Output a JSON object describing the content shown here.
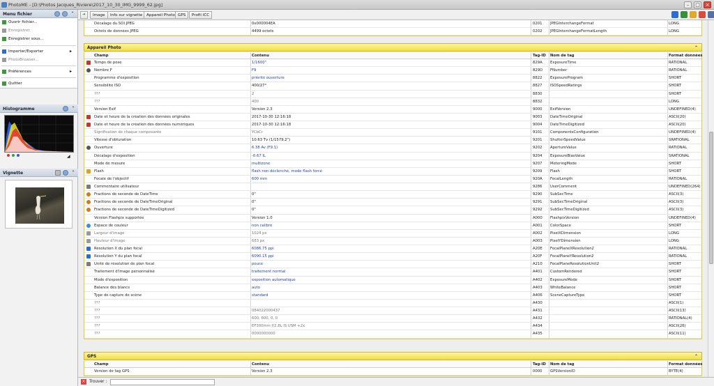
{
  "window": {
    "title": "PhotoME - [D:\\Photos Jacques_Riviere\\2017_10_30_IMG_9999_62.jpg]"
  },
  "left": {
    "menu_title": "Menu fichier",
    "menu": [
      {
        "label": "Ouvrir fichier...",
        "enabled": true,
        "icon": "open-folder-icon"
      },
      {
        "label": "Enregistrer",
        "enabled": false,
        "icon": "save-icon"
      },
      {
        "label": "Enregistrer sous...",
        "enabled": true,
        "icon": "save-as-icon"
      },
      {
        "label": "Importer/Exporter",
        "enabled": true,
        "icon": "import-export-icon",
        "submenu": true
      },
      {
        "label": "PhotoBrowser...",
        "enabled": false,
        "icon": "photo-browser-icon"
      },
      {
        "label": "Préférences",
        "enabled": true,
        "icon": "preferences-icon",
        "submenu": true
      },
      {
        "label": "Quitter",
        "enabled": true,
        "icon": "quit-icon"
      }
    ],
    "histogram_title": "Histogramme",
    "vignette_title": "Vignette"
  },
  "toolbar": {
    "tabs": [
      "Image",
      "Info sur vignette",
      "Appareil Photo",
      "GPS",
      "Profil ICC"
    ]
  },
  "columns": {
    "champ": "Champ",
    "contenu": "Contenu",
    "tag": "Tag-ID",
    "nom": "Nom de tag",
    "format": "Format données"
  },
  "top_rows": [
    {
      "champ": "Décalage du SOI JPEG",
      "contenu": "0x000004EA",
      "tag": "0201",
      "nom": "JPEGInterchangeFormat",
      "format": "LONG"
    },
    {
      "champ": "Octets de données JPEG",
      "contenu": "4499 octets",
      "tag": "0202",
      "nom": "JPEGInterchangeFormatLength",
      "format": "LONG"
    }
  ],
  "camera_section": {
    "title": "Appareil Photo",
    "rows": [
      {
        "champ": "Temps de pose",
        "contenu": "1/1600\"",
        "tag": "829A",
        "nom": "ExposureTime",
        "format": "RATIONAL",
        "icon": "stopwatch-icon",
        "style": "blue"
      },
      {
        "champ": "Nombre F",
        "contenu": "F9",
        "tag": "829D",
        "nom": "FNumber",
        "format": "RATIONAL",
        "icon": "aperture-icon",
        "style": "blue"
      },
      {
        "champ": "Programme d'exposition",
        "contenu": "priorité ouverture",
        "tag": "8822",
        "nom": "ExposureProgram",
        "format": "SHORT",
        "style": "blue"
      },
      {
        "champ": "Sensibilité ISO",
        "contenu": "400/27°",
        "tag": "8827",
        "nom": "ISOSpeedRatings",
        "format": "SHORT"
      },
      {
        "champ": "???",
        "contenu": "2",
        "tag": "8830",
        "nom": "",
        "format": "SHORT",
        "style": "gray"
      },
      {
        "champ": "???",
        "contenu": "400",
        "tag": "8832",
        "nom": "",
        "format": "LONG",
        "style": "gray"
      },
      {
        "champ": "Version Exif",
        "contenu": "Version 2.3",
        "tag": "9000",
        "nom": "ExifVersion",
        "format": "UNDEFINED(4)"
      },
      {
        "champ": "Date et heure de la création des données originales",
        "contenu": "2017-10-30 12:16:18",
        "tag": "9003",
        "nom": "DateTimeOriginal",
        "format": "ASCII(20)",
        "icon": "calendar-icon"
      },
      {
        "champ": "Date et heure de la création des données numériques",
        "contenu": "2017-10-30 12:16:18",
        "tag": "9004",
        "nom": "DateTimeDigitized",
        "format": "ASCII(20)",
        "icon": "calendar-icon"
      },
      {
        "champ": "Signification de chaque composante",
        "contenu": "YCbCr",
        "tag": "9101",
        "nom": "ComponentsConfiguration",
        "format": "UNDEFINED(4)",
        "style": "gray"
      },
      {
        "champ": "Vitesse d'obturation",
        "contenu": "10.63 Tv (1/1579.2\")",
        "tag": "9201",
        "nom": "ShutterSpeedValue",
        "format": "SRATIONAL"
      },
      {
        "champ": "Ouverture",
        "contenu": "6.38 Av (F9.1)",
        "tag": "9202",
        "nom": "ApertureValue",
        "format": "RATIONAL",
        "icon": "aperture-icon",
        "style": "blue"
      },
      {
        "champ": "Décalage d'exposition",
        "contenu": "-0.67 IL",
        "tag": "9204",
        "nom": "ExposureBiasValue",
        "format": "SRATIONAL",
        "style": "blue"
      },
      {
        "champ": "Mode de mesure",
        "contenu": "multizone",
        "tag": "9207",
        "nom": "MeteringMode",
        "format": "SHORT",
        "style": "blue"
      },
      {
        "champ": "Flash",
        "contenu": "flash non déclenché, mode flash forcé",
        "tag": "9209",
        "nom": "Flash",
        "format": "SHORT",
        "icon": "flash-icon",
        "style": "blue"
      },
      {
        "champ": "Focale de l'objectif",
        "contenu": "600 mm",
        "tag": "920A",
        "nom": "FocalLength",
        "format": "RATIONAL",
        "style": "blue"
      },
      {
        "champ": "Commentaire utilisateur",
        "contenu": "",
        "tag": "9286",
        "nom": "UserComment",
        "format": "UNDEFINED(264)",
        "icon": "comment-icon"
      },
      {
        "champ": "Fractions de seconde de DateTime",
        "contenu": "0\"",
        "tag": "9290",
        "nom": "SubSecTime",
        "format": "ASCII(3)",
        "icon": "clock-icon"
      },
      {
        "champ": "Fractions de seconde de DateTimeOriginal",
        "contenu": "0\"",
        "tag": "9291",
        "nom": "SubSecTimeOriginal",
        "format": "ASCII(3)",
        "icon": "clock-icon"
      },
      {
        "champ": "Fractions de seconde de DateTimeDigitized",
        "contenu": "0\"",
        "tag": "9292",
        "nom": "SubSecTimeDigitized",
        "format": "ASCII(3)",
        "icon": "clock-icon"
      },
      {
        "champ": "Version Flashpix supportée",
        "contenu": "Version 1.0",
        "tag": "A000",
        "nom": "FlashpixVersion",
        "format": "UNDEFINED(4)"
      },
      {
        "champ": "Espace de couleur",
        "contenu": "non calibré",
        "tag": "A001",
        "nom": "ColorSpace",
        "format": "SHORT",
        "icon": "color-space-icon",
        "style": "blue"
      },
      {
        "champ": "Largeur d'image",
        "contenu": "1024 px",
        "tag": "A002",
        "nom": "PixelXDimension",
        "format": "LONG",
        "icon": "width-icon",
        "style": "gray"
      },
      {
        "champ": "Hauteur d'image",
        "contenu": "683 px",
        "tag": "A003",
        "nom": "PixelYDimension",
        "format": "LONG",
        "icon": "height-icon",
        "style": "gray"
      },
      {
        "champ": "Résolution X du plan focal",
        "contenu": "6086.75 ppi",
        "tag": "A20E",
        "nom": "FocalPlaneXResolution2",
        "format": "RATIONAL",
        "icon": "resolution-icon",
        "style": "blue"
      },
      {
        "champ": "Résolution Y du plan focal",
        "contenu": "6090.15 ppi",
        "tag": "A20F",
        "nom": "FocalPlaneYResolution2",
        "format": "RATIONAL",
        "icon": "resolution-icon",
        "style": "blue"
      },
      {
        "champ": "Unité de résolution de plan focal",
        "contenu": "pouce",
        "tag": "A210",
        "nom": "FocalPlaneResolutionUnit2",
        "format": "SHORT",
        "icon": "unit-icon",
        "style": "blue"
      },
      {
        "champ": "Traitement d'image personnalisé",
        "contenu": "traitement normal",
        "tag": "A401",
        "nom": "CustomRendered",
        "format": "SHORT",
        "style": "blue"
      },
      {
        "champ": "Mode d'exposition",
        "contenu": "exposition automatique",
        "tag": "A402",
        "nom": "ExposureMode",
        "format": "SHORT",
        "style": "blue"
      },
      {
        "champ": "Balance des blancs",
        "contenu": "auto",
        "tag": "A403",
        "nom": "WhiteBalance",
        "format": "SHORT",
        "style": "blue"
      },
      {
        "champ": "Type de capture de scène",
        "contenu": "standard",
        "tag": "A406",
        "nom": "SceneCaptureType",
        "format": "SHORT",
        "style": "blue"
      },
      {
        "champ": "???",
        "contenu": "",
        "tag": "A430",
        "nom": "",
        "format": "ASCII(1)",
        "style": "gray"
      },
      {
        "champ": "???",
        "contenu": "084022000437",
        "tag": "A431",
        "nom": "",
        "format": "ASCII(13)",
        "style": "gray"
      },
      {
        "champ": "???",
        "contenu": "600, 600, 0, 0",
        "tag": "A432",
        "nom": "",
        "format": "RATIONAL(4)",
        "style": "gray"
      },
      {
        "champ": "???",
        "contenu": "EF300mm f/2.8L IS USM +2x",
        "tag": "A434",
        "nom": "",
        "format": "ASCII(26)",
        "style": "gray"
      },
      {
        "champ": "???",
        "contenu": "0000000000",
        "tag": "A435",
        "nom": "",
        "format": "ASCII(11)",
        "style": "gray"
      }
    ]
  },
  "gps_section": {
    "title": "GPS",
    "rows": [
      {
        "champ": "Version de tag GPS",
        "contenu": "Version 2.3",
        "tag": "0000",
        "nom": "GPSVersionID",
        "format": "BYTE(4)"
      }
    ]
  },
  "findbar": {
    "label": "Trouver :"
  },
  "colors": {
    "section_yellow": "#f1dc42",
    "link_blue": "#1f3fa8"
  }
}
